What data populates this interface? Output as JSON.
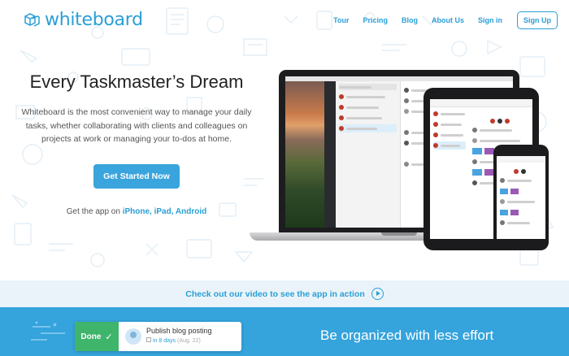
{
  "header": {
    "logo_text": "whiteboard",
    "logo_icon": "whiteboard-cubes-icon",
    "nav": [
      "Tour",
      "Pricing",
      "Blog",
      "About Us",
      "Sign in"
    ],
    "signup_label": "Sign Up"
  },
  "hero": {
    "title": "Every Taskmaster’s Dream",
    "description": "Whiteboard is the most convenient way to manage your daily tasks, whether collaborating with clients and colleagues on projects at work or managing your to-dos at home.",
    "cta_label": "Get Started Now",
    "get_app_prefix": "Get the app on ",
    "platforms": [
      "iPhone",
      "iPad",
      "Android"
    ],
    "separator": ", "
  },
  "video": {
    "label": "Check out our video to see the app in action",
    "icon": "play-circle-icon"
  },
  "band": {
    "done_label": "Done",
    "check_icon": "checkmark-icon",
    "task_title": "Publish blog posting",
    "task_due": "in 8 days",
    "task_date": "(Aug. 22)",
    "headline": "Be organized with less effort"
  },
  "colors": {
    "brand_blue": "#2a9fd6",
    "band_blue": "#35a3dc",
    "done_green": "#3fb46b",
    "strip_bg": "#eaf3f9"
  }
}
